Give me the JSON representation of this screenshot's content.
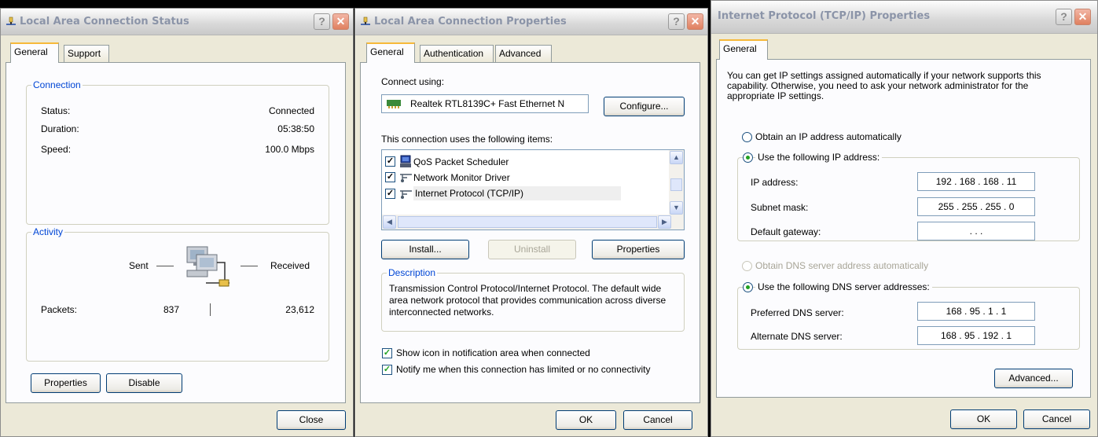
{
  "status_window": {
    "title": "Local Area Connection Status",
    "tabs": [
      "General",
      "Support"
    ],
    "connection_group": "Connection",
    "status_label": "Status:",
    "status_value": "Connected",
    "duration_label": "Duration:",
    "duration_value": "05:38:50",
    "speed_label": "Speed:",
    "speed_value": "100.0 Mbps",
    "activity_group": "Activity",
    "sent_label": "Sent",
    "received_label": "Received",
    "packets_label": "Packets:",
    "packets_sent": "837",
    "packets_received": "23,612",
    "properties_button": "Properties",
    "disable_button": "Disable",
    "close_button": "Close"
  },
  "props_window": {
    "title": "Local Area Connection Properties",
    "tabs": [
      "General",
      "Authentication",
      "Advanced"
    ],
    "connect_using_label": "Connect using:",
    "adapter_name": "Realtek RTL8139C+ Fast Ethernet N",
    "configure_button": "Configure...",
    "items_label": "This connection uses the following items:",
    "items": [
      {
        "label": "QoS Packet Scheduler",
        "icon": "scheduler-icon",
        "checked": true
      },
      {
        "label": "Network Monitor Driver",
        "icon": "network-protocol-icon",
        "checked": true
      },
      {
        "label": "Internet Protocol (TCP/IP)",
        "icon": "network-protocol-icon",
        "checked": true
      }
    ],
    "install_button": "Install...",
    "uninstall_button": "Uninstall",
    "properties_button": "Properties",
    "description_group": "Description",
    "description_text": "Transmission Control Protocol/Internet Protocol. The default wide area network protocol that provides communication across diverse interconnected networks.",
    "show_icon_label": "Show icon in notification area when connected",
    "notify_label": "Notify me when this connection has limited or no connectivity",
    "ok_button": "OK",
    "cancel_button": "Cancel"
  },
  "tcpip_window": {
    "title": "Internet Protocol (TCP/IP) Properties",
    "tab": "General",
    "intro_text": "You can get IP settings assigned automatically if your network supports this capability. Otherwise, you need to ask your network administrator for the appropriate IP settings.",
    "obtain_ip_label": "Obtain an IP address automatically",
    "use_ip_label": "Use the following IP address:",
    "ip_label": "IP address:",
    "ip_value": "192 . 168 . 168 . 11",
    "subnet_label": "Subnet mask:",
    "subnet_value": "255 . 255 . 255 . 0",
    "gateway_label": "Default gateway:",
    "gateway_value": ".        .        .",
    "obtain_dns_label": "Obtain DNS server address automatically",
    "use_dns_label": "Use the following DNS server addresses:",
    "preferred_dns_label": "Preferred DNS server:",
    "preferred_dns_value": "168 . 95 . 1 . 1",
    "alternate_dns_label": "Alternate DNS server:",
    "alternate_dns_value": "168 . 95 . 192 . 1",
    "advanced_button": "Advanced...",
    "ok_button": "OK",
    "cancel_button": "Cancel"
  }
}
